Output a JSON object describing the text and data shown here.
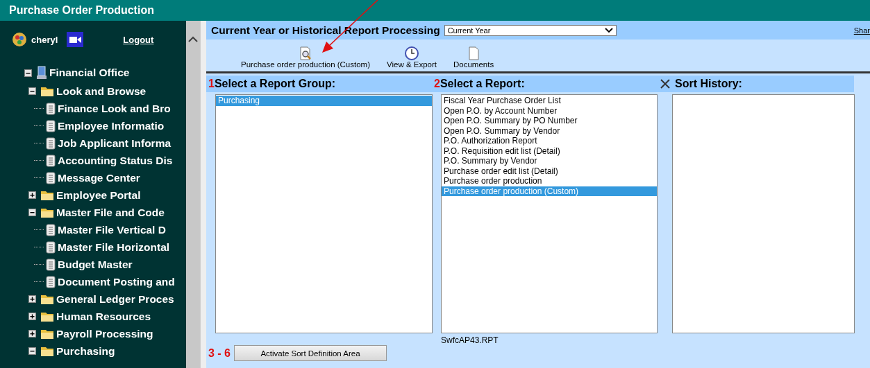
{
  "window": {
    "title": "Purchase Order Production"
  },
  "user": {
    "name": "cheryl",
    "logout": "Logout"
  },
  "tree": [
    {
      "label": "Financial Office",
      "kind": "computer",
      "expanded": true,
      "children": [
        {
          "label": "Look and Browse",
          "kind": "folder",
          "expanded": true,
          "children": [
            {
              "label": "Finance Look and Bro",
              "kind": "document"
            },
            {
              "label": "Employee Informatio",
              "kind": "document"
            },
            {
              "label": "Job Applicant Informa",
              "kind": "document"
            },
            {
              "label": "Accounting Status Dis",
              "kind": "document"
            },
            {
              "label": "Message Center",
              "kind": "document"
            }
          ]
        },
        {
          "label": "Employee Portal",
          "kind": "folder",
          "expanded": false
        },
        {
          "label": "Master File and Code",
          "kind": "folder",
          "expanded": true,
          "children": [
            {
              "label": "Master File Vertical D",
              "kind": "document"
            },
            {
              "label": "Master File Horizontal",
              "kind": "document"
            },
            {
              "label": "Budget Master",
              "kind": "document"
            },
            {
              "label": "Document Posting and",
              "kind": "document"
            }
          ]
        },
        {
          "label": "General Ledger Proces",
          "kind": "folder",
          "expanded": false
        },
        {
          "label": "Human Resources",
          "kind": "folder",
          "expanded": false
        },
        {
          "label": "Payroll Processing",
          "kind": "folder",
          "expanded": false
        },
        {
          "label": "Purchasing",
          "kind": "folder",
          "expanded": true
        }
      ]
    }
  ],
  "header": {
    "title": "Current Year or Historical Report Processing",
    "period": "Current Year",
    "link": "Shar"
  },
  "toolbar": [
    {
      "label": "Purchase order production (Custom)",
      "kind": "preview"
    },
    {
      "label": "View & Export",
      "kind": "clock"
    },
    {
      "label": "Documents",
      "kind": "page"
    }
  ],
  "report_groups": {
    "step": "1",
    "heading": "Select a Report Group:",
    "items": [
      {
        "label": "Purchasing",
        "selected": true
      }
    ]
  },
  "reports": {
    "step": "2",
    "heading": "Select a Report:",
    "file": "SwfcAP43.RPT",
    "items": [
      {
        "label": "Fiscal Year Purchase Order List",
        "selected": false
      },
      {
        "label": "Open P.O. by Account Number",
        "selected": false
      },
      {
        "label": "Open P.O. Summary by PO Number",
        "selected": false
      },
      {
        "label": "Open P.O. Summary by Vendor",
        "selected": false
      },
      {
        "label": "P.O. Authorization Report",
        "selected": false
      },
      {
        "label": "P.O. Requisition edit list (Detail)",
        "selected": false
      },
      {
        "label": "P.O. Summary by Vendor",
        "selected": false
      },
      {
        "label": "Purchase order edit list (Detail)",
        "selected": false
      },
      {
        "label": "Purchase order production",
        "selected": false
      },
      {
        "label": "Purchase order production (Custom)",
        "selected": true
      }
    ]
  },
  "sort_history": {
    "heading": "Sort History:"
  },
  "sort_definition": {
    "step": "3 - 6",
    "button": "Activate Sort Definition Area"
  }
}
